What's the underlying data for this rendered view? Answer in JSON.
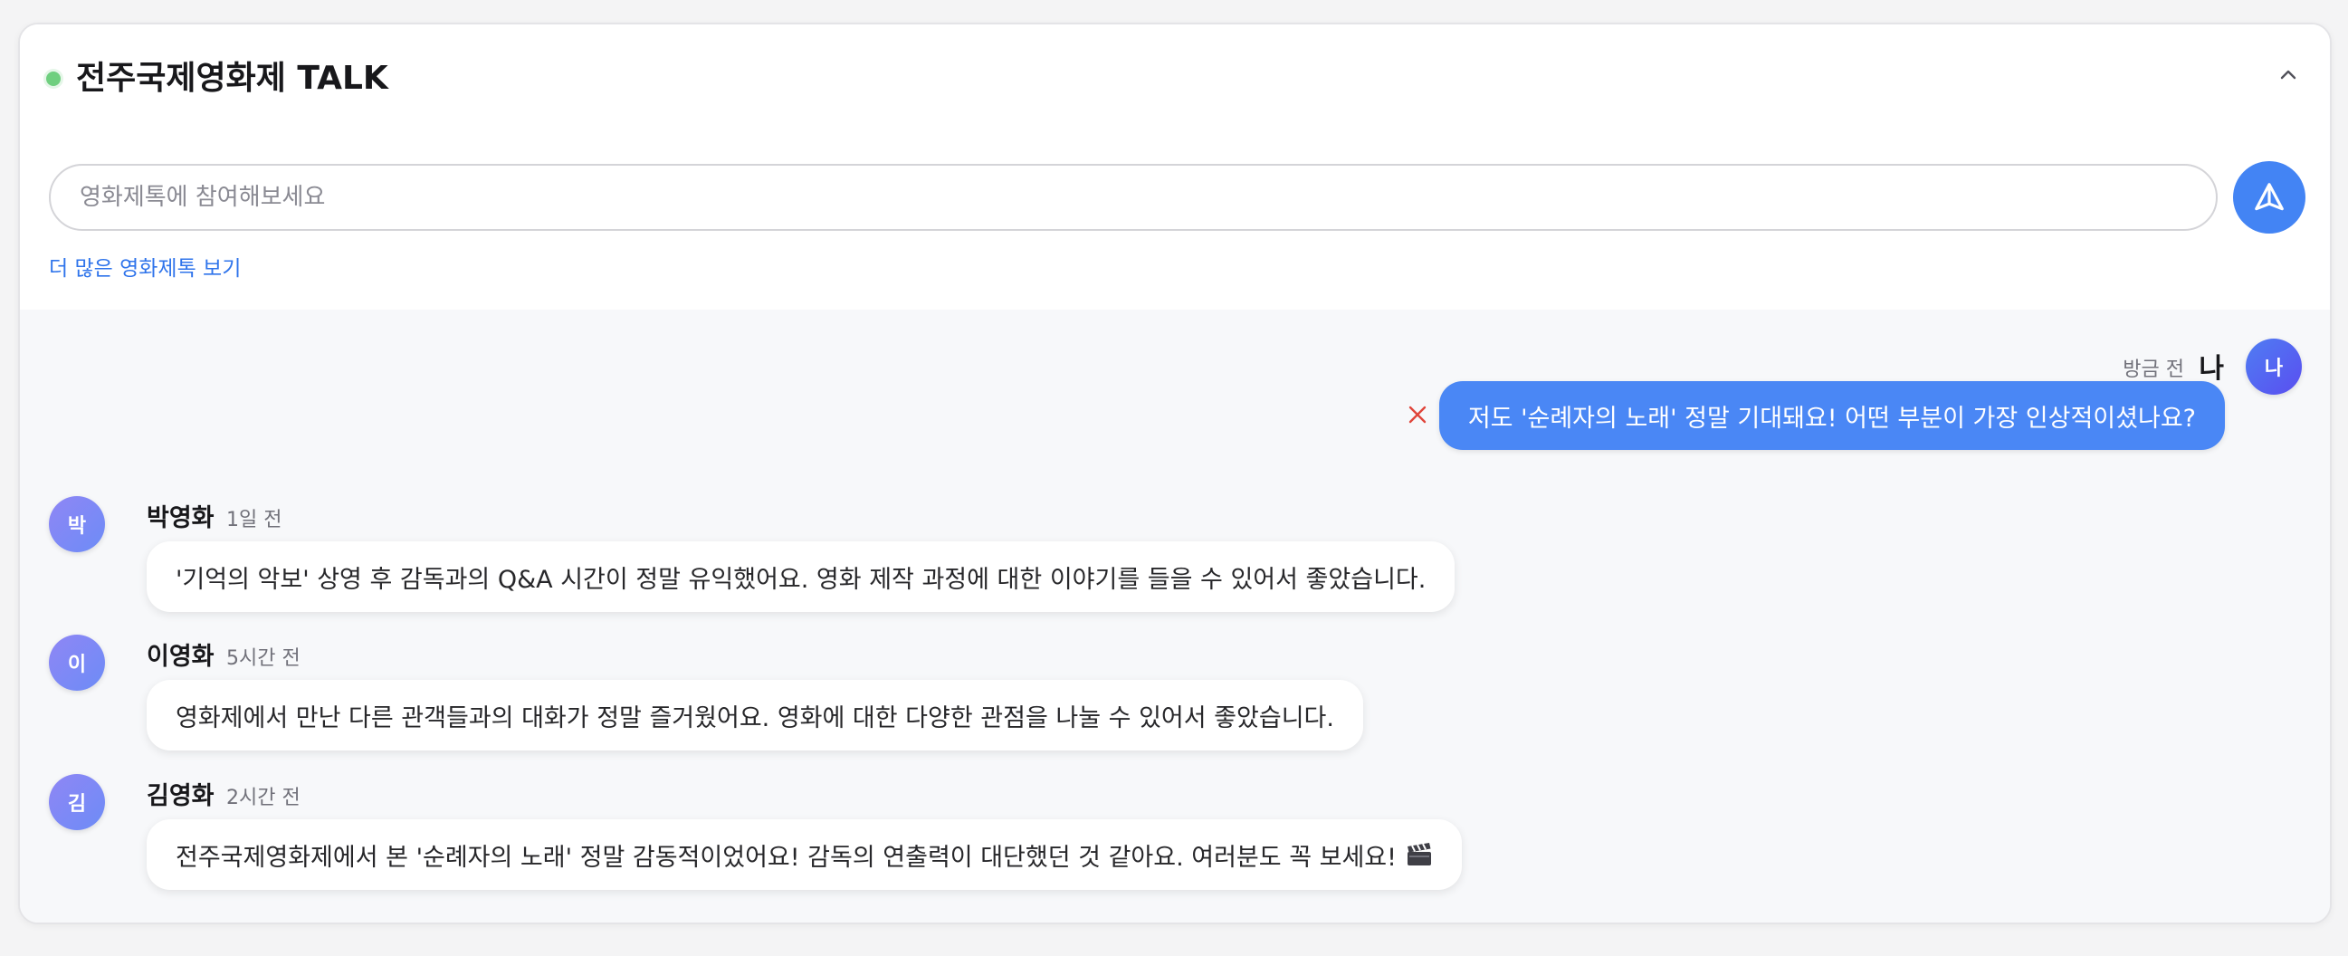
{
  "header": {
    "title": "전주국제영화제 TALK",
    "status_color": "#6fcf7f"
  },
  "composer": {
    "placeholder": "영화제톡에 참여해보세요",
    "more_link": "더 많은 영화제톡 보기",
    "send_icon": "send-icon"
  },
  "my_message": {
    "avatar": "나",
    "name": "나",
    "time": "방금 전",
    "text": "저도 '순례자의 노래' 정말 기대돼요! 어떤 부분이 가장 인상적이셨나요?"
  },
  "messages": [
    {
      "avatar": "박",
      "name": "박영화",
      "time": "1일 전",
      "text": "'기억의 악보' 상영 후 감독과의 Q&A 시간이 정말 유익했어요. 영화 제작 과정에 대한 이야기를 들을 수 있어서 좋았습니다."
    },
    {
      "avatar": "이",
      "name": "이영화",
      "time": "5시간 전",
      "text": "영화제에서 만난 다른 관객들과의 대화가 정말 즐거웠어요. 영화에 대한 다양한 관점을 나눌 수 있어서 좋았습니다."
    },
    {
      "avatar": "김",
      "name": "김영화",
      "time": "2시간 전",
      "text": "전주국제영화제에서 본 '순례자의 노래' 정말 감동적이었어요! 감독의 연출력이 대단했던 것 같아요. 여러분도 꼭 보세요!",
      "emoji_icon": "clapperboard-icon"
    }
  ],
  "colors": {
    "accent": "#4a87f5",
    "link": "#2f74eb",
    "delete": "#e0453a"
  }
}
